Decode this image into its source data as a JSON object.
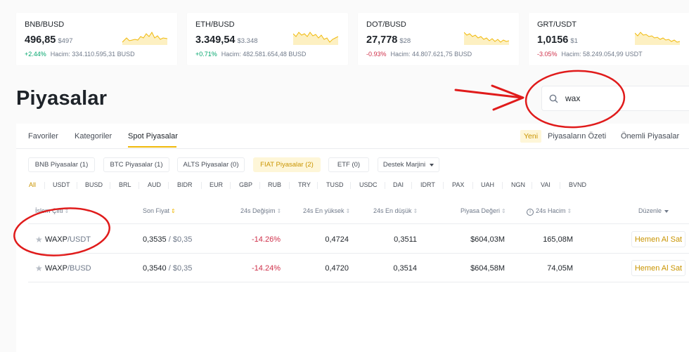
{
  "tickers": [
    {
      "pair": "BNB/BUSD",
      "price": "496,85",
      "usd": "$497",
      "change": "+2.44%",
      "dir": "up",
      "volume": "Hacim: 334.110.595,31 BUSD"
    },
    {
      "pair": "ETH/BUSD",
      "price": "3.349,54",
      "usd": "$3.348",
      "change": "+0.71%",
      "dir": "up",
      "volume": "Hacim: 482.581.654,48 BUSD"
    },
    {
      "pair": "DOT/BUSD",
      "price": "27,778",
      "usd": "$28",
      "change": "-0.93%",
      "dir": "down",
      "volume": "Hacim: 44.807.621,75 BUSD"
    },
    {
      "pair": "GRT/USDT",
      "price": "1,0156",
      "usd": "$1",
      "change": "-3.05%",
      "dir": "down",
      "volume": "Hacim: 58.249.054,99 USDT"
    }
  ],
  "page": {
    "title": "Piyasalar"
  },
  "search": {
    "value": "wax"
  },
  "tabs": {
    "favorites": "Favoriler",
    "categories": "Kategoriler",
    "spot": "Spot Piyasalar",
    "new_badge": "Yeni",
    "overview": "Piyasaların Özeti",
    "important": "Önemli Piyasalar"
  },
  "filters": {
    "bnb": "BNB Piyasalar (1)",
    "btc": "BTC Piyasalar (1)",
    "alts": "ALTS Piyasalar (0)",
    "fiat": "FIAT Piyasalar (2)",
    "etf": "ETF (0)",
    "margin": "Destek Marjini"
  },
  "quotes": [
    "All",
    "USDT",
    "BUSD",
    "BRL",
    "AUD",
    "BIDR",
    "EUR",
    "GBP",
    "RUB",
    "TRY",
    "TUSD",
    "USDC",
    "DAI",
    "IDRT",
    "PAX",
    "UAH",
    "NGN",
    "VAI",
    "BVND"
  ],
  "table": {
    "headers": {
      "pair": "İşlem Çifti",
      "price": "Son Fiyat",
      "change": "24s Değişim",
      "high": "24s En yüksek",
      "low": "24s En düşük",
      "mcap": "Piyasa Değeri",
      "volume": "24s Hacim",
      "edit": "Düzenle"
    },
    "rows": [
      {
        "base": "WAXP",
        "quote": "/USDT",
        "price": "0,3535",
        "price_usd": " / $0,35",
        "change": "-14.26%",
        "high": "0,4724",
        "low": "0,3511",
        "mcap": "$604,03M",
        "volume": "165,08M",
        "action": "Hemen Al Sat"
      },
      {
        "base": "WAXP",
        "quote": "/BUSD",
        "price": "0,3540",
        "price_usd": " / $0,35",
        "change": "-14.24%",
        "high": "0,4720",
        "low": "0,3514",
        "mcap": "$604,58M",
        "volume": "74,05M",
        "action": "Hemen Al Sat"
      }
    ]
  },
  "colors": {
    "accent": "#f0b90b",
    "up": "#03a66d",
    "down": "#cf304a",
    "annotation": "#e01b1b"
  }
}
